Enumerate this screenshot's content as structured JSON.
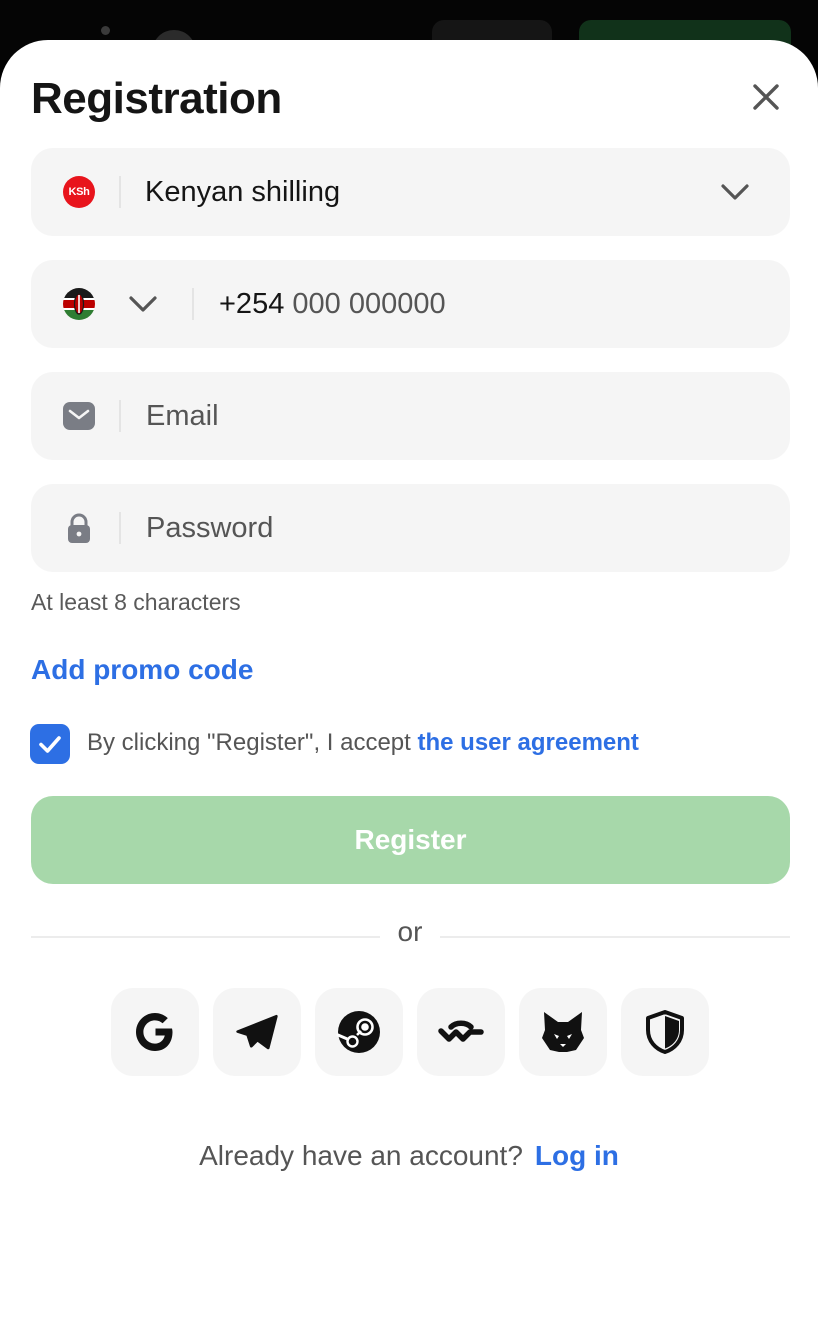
{
  "header": {
    "title": "Registration"
  },
  "currency": {
    "badge": "KSh",
    "label": "Kenyan shilling"
  },
  "phone": {
    "code": "+254",
    "placeholder": "000 000000"
  },
  "email": {
    "placeholder": "Email"
  },
  "password": {
    "placeholder": "Password",
    "hint": "At least 8 characters"
  },
  "promo": {
    "label": "Add promo code"
  },
  "agreement": {
    "checked": true,
    "text": "By clicking \"Register\", I accept ",
    "link": "the user agreement"
  },
  "register": {
    "label": "Register"
  },
  "divider": {
    "text": "or"
  },
  "social": [
    {
      "icon": "google-icon"
    },
    {
      "icon": "telegram-icon"
    },
    {
      "icon": "steam-icon"
    },
    {
      "icon": "walletconnect-icon"
    },
    {
      "icon": "metamask-fox-icon"
    },
    {
      "icon": "shield-icon"
    }
  ],
  "footer": {
    "text": "Already have an account?",
    "login": "Log in"
  },
  "colors": {
    "accent": "#2d6fe4",
    "register_disabled": "#a7d8aa",
    "field_bg": "#f5f5f5",
    "currency_badge": "#e8141c"
  }
}
